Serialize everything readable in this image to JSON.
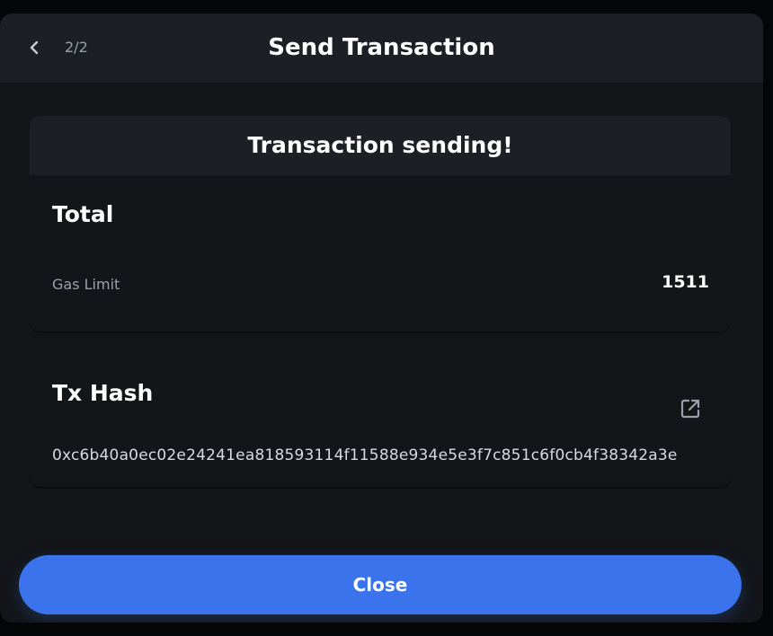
{
  "header": {
    "step": "2/2",
    "title": "Send Transaction",
    "back_icon": "chevron-left-icon"
  },
  "status": {
    "text": "Transaction sending!"
  },
  "total": {
    "heading": "Total",
    "gas_limit_label": "Gas Limit",
    "gas_limit_value": "1511"
  },
  "tx_hash": {
    "heading": "Tx Hash",
    "value": "0xc6b40a0ec02e24241ea818593114f11588e934e5e3f7c851c6f0cb4f38342a3e",
    "link_icon": "external-link-icon"
  },
  "actions": {
    "close_label": "Close"
  },
  "colors": {
    "background": "#131519",
    "panel": "#1c1f24",
    "accent": "#3b73ec",
    "muted_text": "#9aa0ab"
  }
}
